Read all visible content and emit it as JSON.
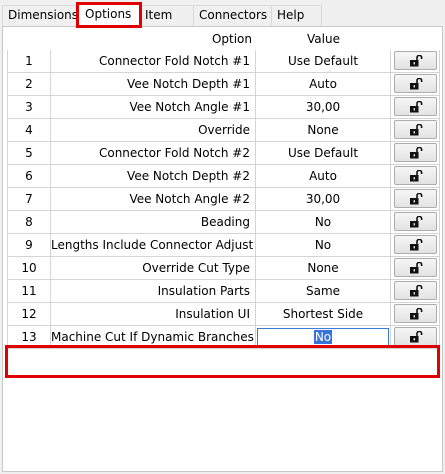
{
  "tabs": [
    {
      "label": "Dimensions",
      "active": false
    },
    {
      "label": "Options",
      "active": true
    },
    {
      "label": "Item",
      "active": false
    },
    {
      "label": "Connectors",
      "active": false
    },
    {
      "label": "Help",
      "active": false
    }
  ],
  "grid": {
    "headers": {
      "option": "Option",
      "value": "Value"
    },
    "rows": [
      {
        "num": "1",
        "option": "Connector Fold Notch #1",
        "value": "Use Default"
      },
      {
        "num": "2",
        "option": "Vee Notch Depth #1",
        "value": "Auto"
      },
      {
        "num": "3",
        "option": "Vee Notch Angle #1",
        "value": "30,00"
      },
      {
        "num": "4",
        "option": "Override",
        "value": "None"
      },
      {
        "num": "5",
        "option": "Connector Fold Notch #2",
        "value": "Use Default"
      },
      {
        "num": "6",
        "option": "Vee Notch Depth #2",
        "value": "Auto"
      },
      {
        "num": "7",
        "option": "Vee Notch Angle #2",
        "value": "30,00"
      },
      {
        "num": "8",
        "option": "Beading",
        "value": "No"
      },
      {
        "num": "9",
        "option": "Lengths Include Connector Adjust",
        "value": "No"
      },
      {
        "num": "10",
        "option": "Override Cut Type",
        "value": "None"
      },
      {
        "num": "11",
        "option": "Insulation Parts",
        "value": "Same"
      },
      {
        "num": "12",
        "option": "Insulation UI",
        "value": "Shortest Side"
      },
      {
        "num": "13",
        "option": "Machine Cut If Dynamic Branches",
        "value": "No"
      }
    ],
    "editing_row_index": 12,
    "lock_icon": "unlocked-padlock-icon"
  },
  "colors": {
    "highlight": "#e00000",
    "selection": "#3874d8"
  }
}
